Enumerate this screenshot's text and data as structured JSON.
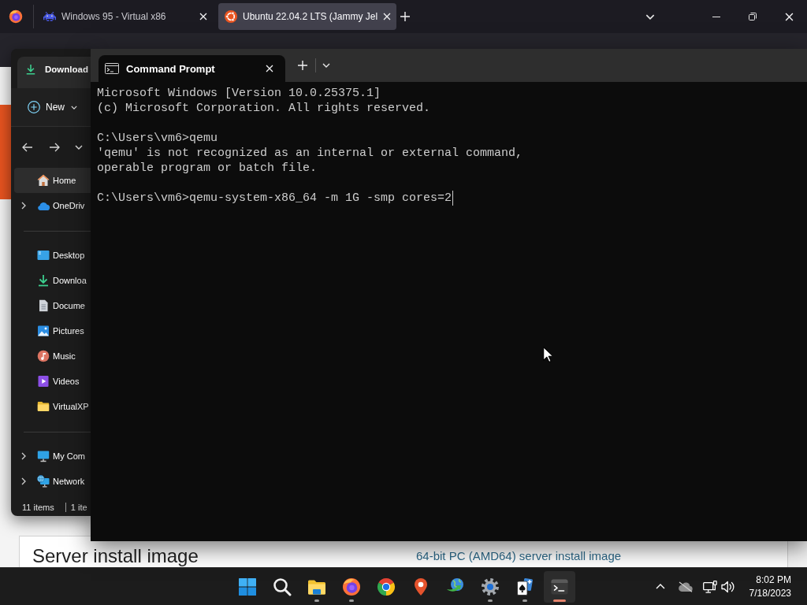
{
  "browser": {
    "tabs": [
      {
        "title": "Windows 95 - Virtual x86",
        "selected": false
      },
      {
        "title": "Ubuntu 22.04.2 LTS (Jammy Jel",
        "selected": true
      }
    ],
    "page": {
      "heading": "Server install image",
      "link": "64-bit PC (AMD64) server install image"
    }
  },
  "explorer": {
    "tab_title": "Download",
    "new_button": "New",
    "sidebar": [
      [
        {
          "label": "Home",
          "selected": true
        },
        {
          "label": "OneDriv",
          "selected": false,
          "expanded": false
        }
      ],
      [
        {
          "label": "Desktop",
          "selected": false
        },
        {
          "label": "Downloa",
          "selected": false
        },
        {
          "label": "Docume",
          "selected": false
        },
        {
          "label": "Pictures",
          "selected": false
        },
        {
          "label": "Music",
          "selected": false
        },
        {
          "label": "Videos",
          "selected": false
        },
        {
          "label": "VirtualXP",
          "selected": false
        }
      ],
      [
        {
          "label": "My Com",
          "selected": false,
          "expanded": false
        },
        {
          "label": "Network",
          "selected": false,
          "expanded": false
        }
      ]
    ],
    "status_bar": [
      "11 items",
      "1 ite"
    ]
  },
  "terminal": {
    "tab_title": "Command Prompt",
    "blocks": [
      [
        "Microsoft Windows [Version 10.0.25375.1]",
        "(c) Microsoft Corporation. All rights reserved."
      ],
      [
        "C:\\Users\\vm6>qemu",
        "'qemu' is not recognized as an internal or external command,",
        "operable program or batch file."
      ],
      [
        "C:\\Users\\vm6>qemu-system-x86_64 -m 1G -smp cores=2"
      ]
    ]
  },
  "taskbar": {
    "apps": [
      {
        "active": false
      },
      {
        "active": false
      },
      {
        "running": true,
        "active": false
      },
      {
        "running": true,
        "active": false
      },
      {
        "running": false,
        "active": false
      },
      {
        "running": false,
        "active": false
      },
      {
        "running": false,
        "active": false
      },
      {
        "running": true,
        "active": false
      },
      {
        "running": true,
        "active": false
      },
      {
        "running": true,
        "active": true
      }
    ],
    "time": "8:02 PM",
    "date": "7/18/2023"
  }
}
